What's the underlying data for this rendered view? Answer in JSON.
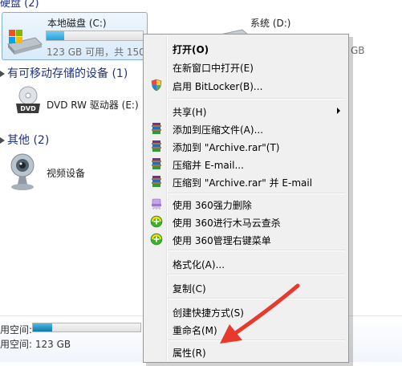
{
  "explorer": {
    "group_hard_disks": "硬盘 (2)",
    "group_removable": "有可移动存储的设备 (1)",
    "group_other": "其他 (2)",
    "drive_c": {
      "label": "本地磁盘 (C:)",
      "free_text": "123 GB 可用，共 150",
      "used_fraction": 0.18
    },
    "drive_d": {
      "label": "系统 (D:)",
      "free_text": "GB"
    },
    "dvd": {
      "label": "DVD RW 驱动器 (E:)"
    },
    "video": {
      "label": "视频设备"
    },
    "status": {
      "space_label": "用空间:",
      "free_label": "用空间: 123 GB",
      "used_fraction": 0.18
    }
  },
  "context_menu": {
    "items": [
      {
        "label": "打开(O)",
        "icon": "none",
        "bold": true
      },
      {
        "label": "在新窗口中打开(E)",
        "icon": "none"
      },
      {
        "label": "启用 BitLocker(B)...",
        "icon": "shield-icon"
      },
      {
        "label": "共享(H)",
        "icon": "none",
        "submenu": true
      },
      {
        "label": "添加到压缩文件(A)...",
        "icon": "winrar-icon"
      },
      {
        "label": "添加到 \"Archive.rar\"(T)",
        "icon": "winrar-icon"
      },
      {
        "label": "压缩并 E-mail...",
        "icon": "winrar-icon"
      },
      {
        "label": "压缩到 \"Archive.rar\" 并 E-mail",
        "icon": "winrar-icon"
      },
      {
        "label": "使用 360强力删除",
        "icon": "shred-icon"
      },
      {
        "label": "使用 360进行木马云查杀",
        "icon": "360-icon"
      },
      {
        "label": "使用 360管理右键菜单",
        "icon": "360-icon"
      },
      {
        "label": "格式化(A)...",
        "icon": "none"
      },
      {
        "label": "复制(C)",
        "icon": "none"
      },
      {
        "label": "创建快捷方式(S)",
        "icon": "none"
      },
      {
        "label": "重命名(M)",
        "icon": "none"
      },
      {
        "label": "属性(R)",
        "icon": "none"
      }
    ]
  },
  "colors": {
    "annotation_arrow": "#e8392d",
    "selection": "#cce8ff",
    "bar_fill": "#26a0da"
  }
}
